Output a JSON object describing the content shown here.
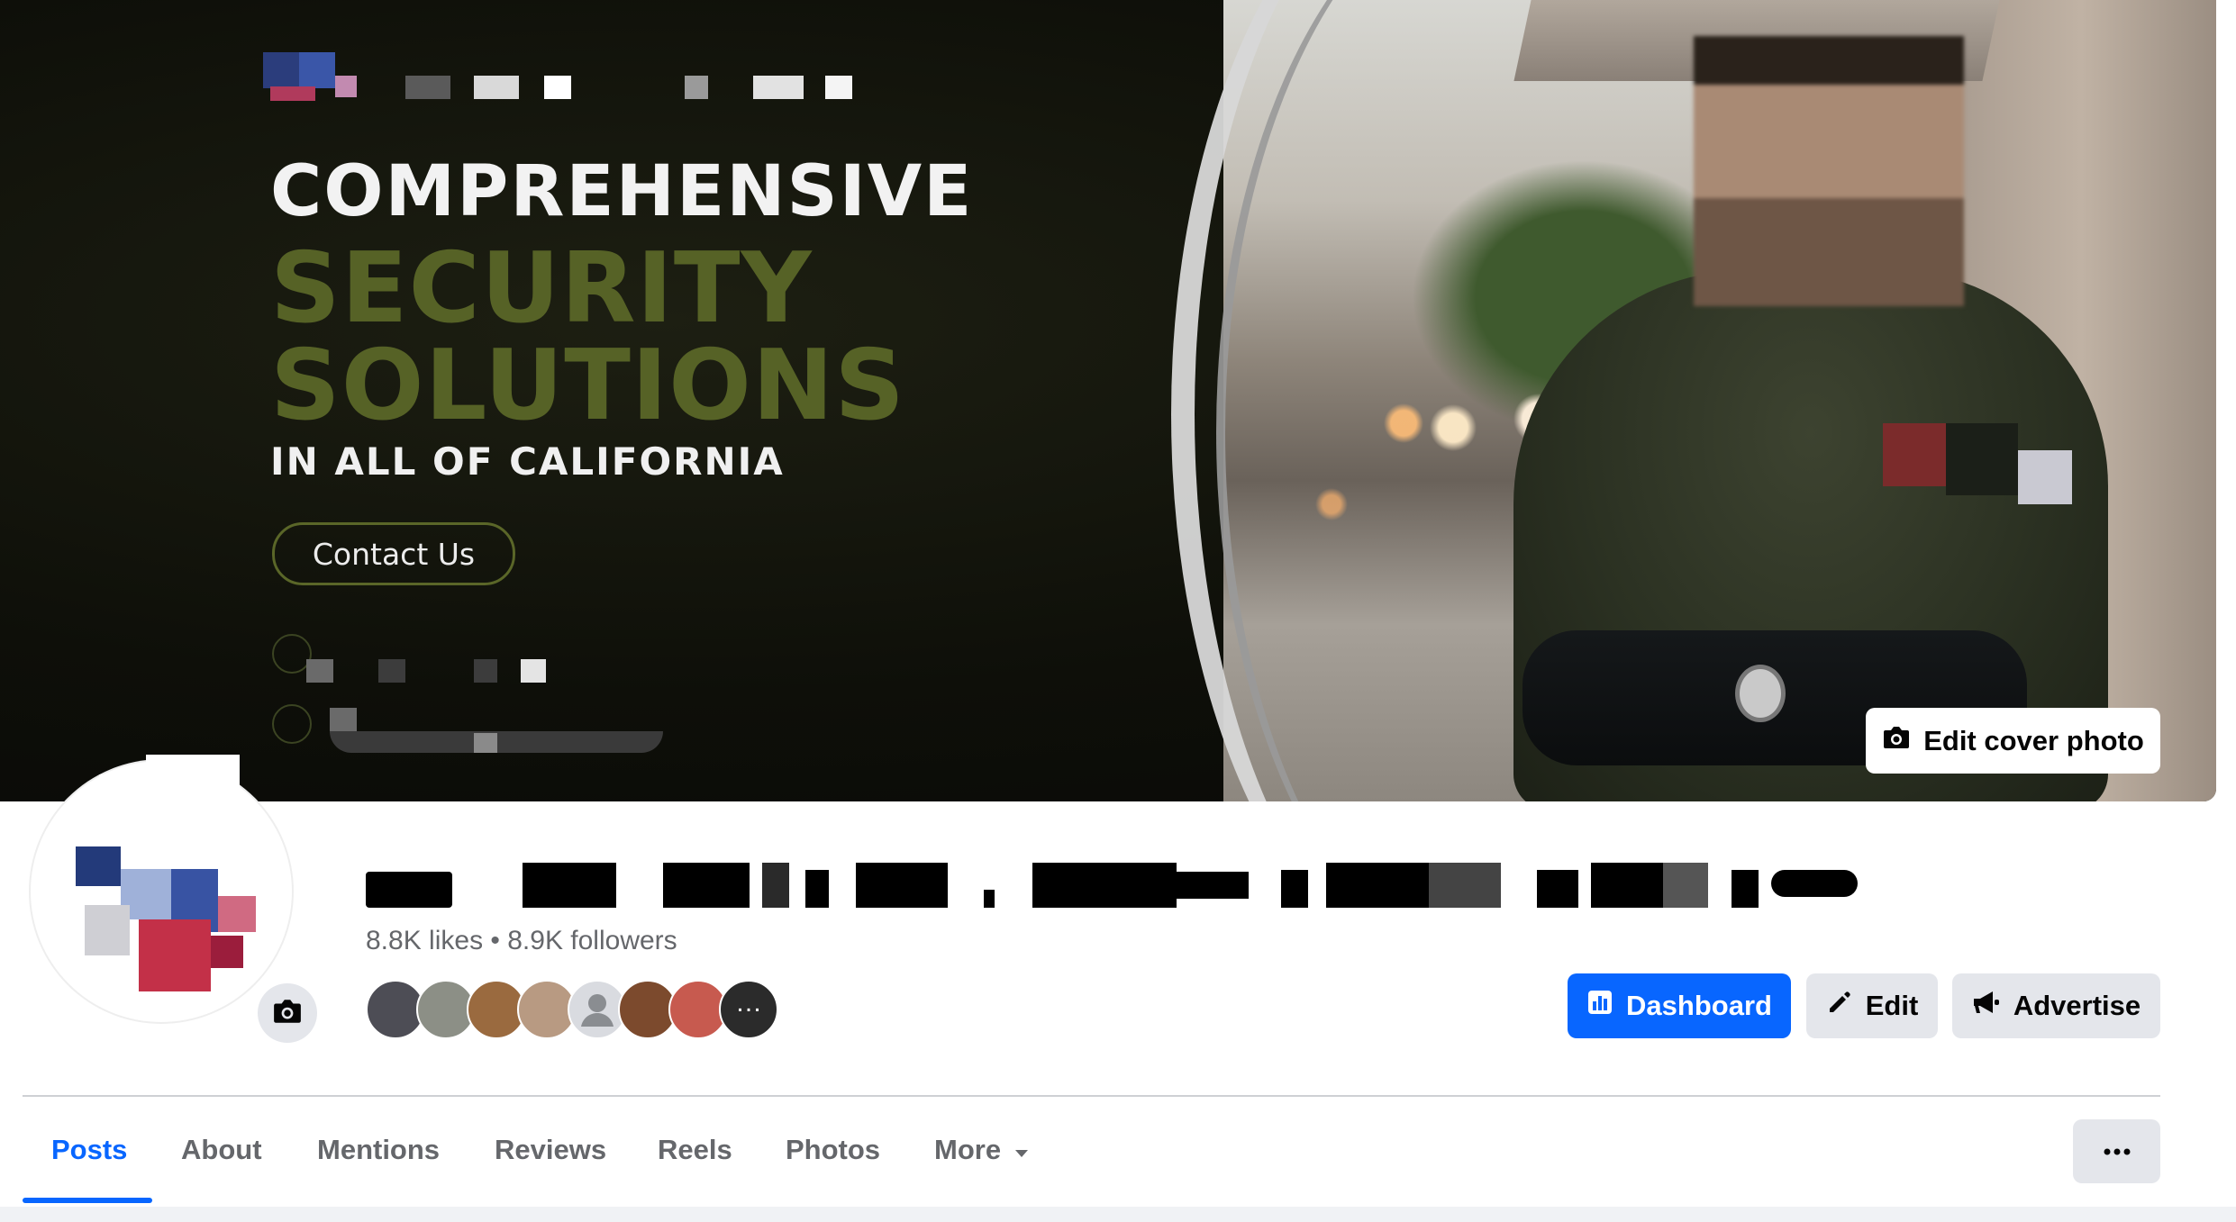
{
  "cover": {
    "headline_1": "COMPREHENSIVE",
    "headline_2": "SECURITY",
    "headline_3": "SOLUTIONS",
    "headline_4": "IN ALL OF CALIFORNIA",
    "contact_label": "Contact Us",
    "edit_cover_label": "Edit cover photo"
  },
  "profile": {
    "stats": "8.8K likes • 8.9K followers"
  },
  "actions": {
    "dashboard": "Dashboard",
    "edit": "Edit",
    "advertise": "Advertise"
  },
  "tabs": [
    {
      "label": "Posts"
    },
    {
      "label": "About"
    },
    {
      "label": "Mentions"
    },
    {
      "label": "Reviews"
    },
    {
      "label": "Reels"
    },
    {
      "label": "Photos"
    },
    {
      "label": "More"
    }
  ],
  "colors": {
    "accent": "#0866ff",
    "cover_olive": "#566226",
    "button_gray": "#e4e6eb"
  }
}
